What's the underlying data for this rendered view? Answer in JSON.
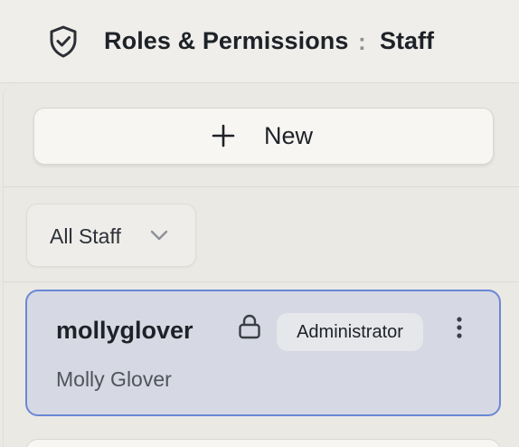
{
  "header": {
    "icon": "shield-check-icon",
    "title": "Roles & Permissions",
    "separator": ":",
    "current": "Staff"
  },
  "toolbar": {
    "new_label": "New",
    "new_icon": "plus-icon"
  },
  "filter": {
    "selected": "All Staff",
    "icon": "chevron-down-icon"
  },
  "staff": [
    {
      "username": "mollyglover",
      "full_name": "Molly Glover",
      "role": "Administrator",
      "locked": true,
      "selected": true
    }
  ],
  "colors": {
    "selected_border": "#6a88d6",
    "selected_background": "#d6d9e3"
  }
}
